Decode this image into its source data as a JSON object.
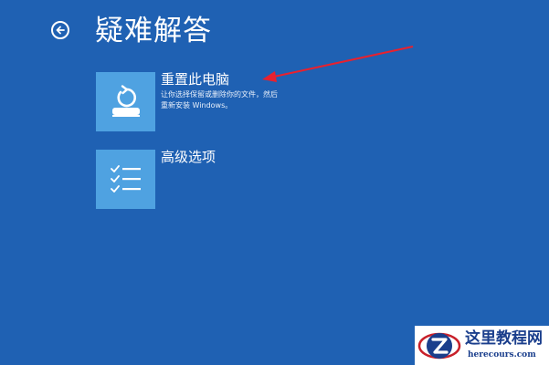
{
  "header": {
    "title": "疑难解答",
    "back_icon": "back-arrow-circle-icon"
  },
  "options": [
    {
      "label": "重置此电脑",
      "description_lines": [
        "让你选择保留或删除你的文件，然后",
        "重新安装 Windows。"
      ],
      "icon": "reset-pc-icon"
    },
    {
      "label": "高级选项",
      "icon": "checklist-icon"
    }
  ],
  "annotation": {
    "color": "#e8212e"
  },
  "watermark": {
    "title": "这里教程网",
    "url": "herecours.com"
  },
  "colors": {
    "background": "#1f61b3",
    "tile": "#4fa2e1",
    "text": "#ffffff"
  }
}
